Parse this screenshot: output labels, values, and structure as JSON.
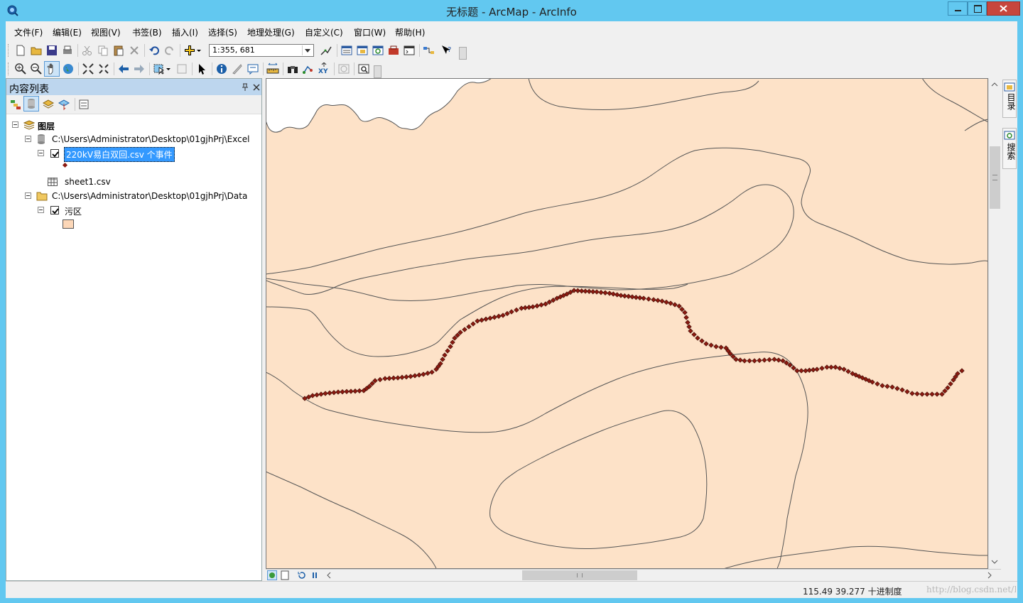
{
  "window": {
    "title": "无标题 - ArcMap - ArcInfo"
  },
  "menu": {
    "items": [
      {
        "label": "文件(F)"
      },
      {
        "label": "编辑(E)"
      },
      {
        "label": "视图(V)"
      },
      {
        "label": "书签(B)"
      },
      {
        "label": "插入(I)"
      },
      {
        "label": "选择(S)"
      },
      {
        "label": "地理处理(G)"
      },
      {
        "label": "自定义(C)"
      },
      {
        "label": "窗口(W)"
      },
      {
        "label": "帮助(H)"
      }
    ]
  },
  "toolbar": {
    "scale_value": "1:355, 681"
  },
  "toc": {
    "title": "内容列表",
    "root_label": "图层",
    "excel_path": "C:\\Users\\Administrator\\Desktop\\01gjhPrj\\Excel",
    "events_layer": "220kV易白双回.csv 个事件",
    "sheet_table": "sheet1.csv",
    "data_path": "C:\\Users\\Administrator\\Desktop\\01gjhPrj\\Data",
    "region_layer": "污区",
    "events_checked": true,
    "region_checked": true
  },
  "dock": {
    "catalog_label": "目录",
    "search_label": "搜索"
  },
  "status": {
    "coordinates": "115.49  39.277 十进制度",
    "watermark": "http://blog.csdn.net/LSGO_MYP"
  },
  "colors": {
    "title_bar": "#62c8f0",
    "map_fill": "#fde2c8",
    "region_swatch": "#fcd7b8",
    "event_point": "#8b1a10",
    "selection": "#3399ff"
  }
}
